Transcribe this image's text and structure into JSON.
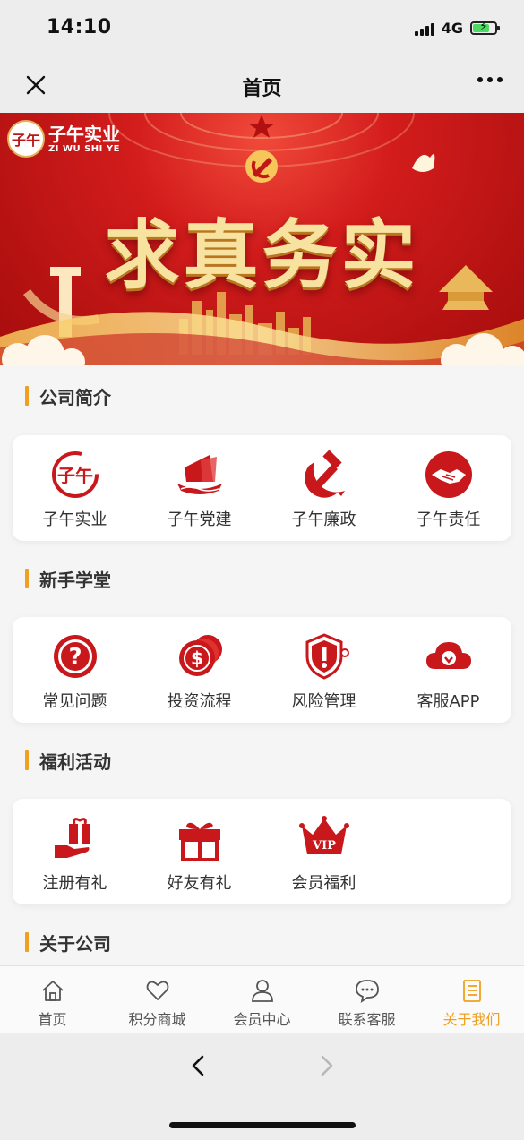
{
  "status_bar": {
    "time": "14:10",
    "network": "4G",
    "battery_level": 0.7
  },
  "nav": {
    "title": "首页"
  },
  "banner": {
    "logo_text": "子午实业",
    "logo_subtext": "ZI WU SHI YE",
    "slogan": "求真务实"
  },
  "sections": [
    {
      "title": "公司简介",
      "items": [
        {
          "label": "子午实业",
          "icon": "company-logo-icon"
        },
        {
          "label": "子午党建",
          "icon": "party-building-icon"
        },
        {
          "label": "子午廉政",
          "icon": "hammer-sickle-icon"
        },
        {
          "label": "子午责任",
          "icon": "handshake-icon"
        }
      ]
    },
    {
      "title": "新手学堂",
      "items": [
        {
          "label": "常见问题",
          "icon": "question-icon"
        },
        {
          "label": "投资流程",
          "icon": "dollar-coins-icon"
        },
        {
          "label": "风险管理",
          "icon": "shield-alert-icon"
        },
        {
          "label": "客服APP",
          "icon": "cloud-download-icon"
        }
      ]
    },
    {
      "title": "福利活动",
      "items": [
        {
          "label": "注册有礼",
          "icon": "hand-gift-icon"
        },
        {
          "label": "好友有礼",
          "icon": "gift-box-icon"
        },
        {
          "label": "会员福利",
          "icon": "vip-crown-icon"
        }
      ]
    },
    {
      "title": "关于公司"
    }
  ],
  "tabs": [
    {
      "label": "首页",
      "icon": "home-icon"
    },
    {
      "label": "积分商城",
      "icon": "heart-icon"
    },
    {
      "label": "会员中心",
      "icon": "user-icon"
    },
    {
      "label": "联系客服",
      "icon": "chat-icon"
    },
    {
      "label": "关于我们",
      "icon": "document-icon",
      "active": true
    }
  ],
  "colors": {
    "accent": "#f0a020",
    "brand_red": "#d0191c",
    "text": "#333333"
  }
}
